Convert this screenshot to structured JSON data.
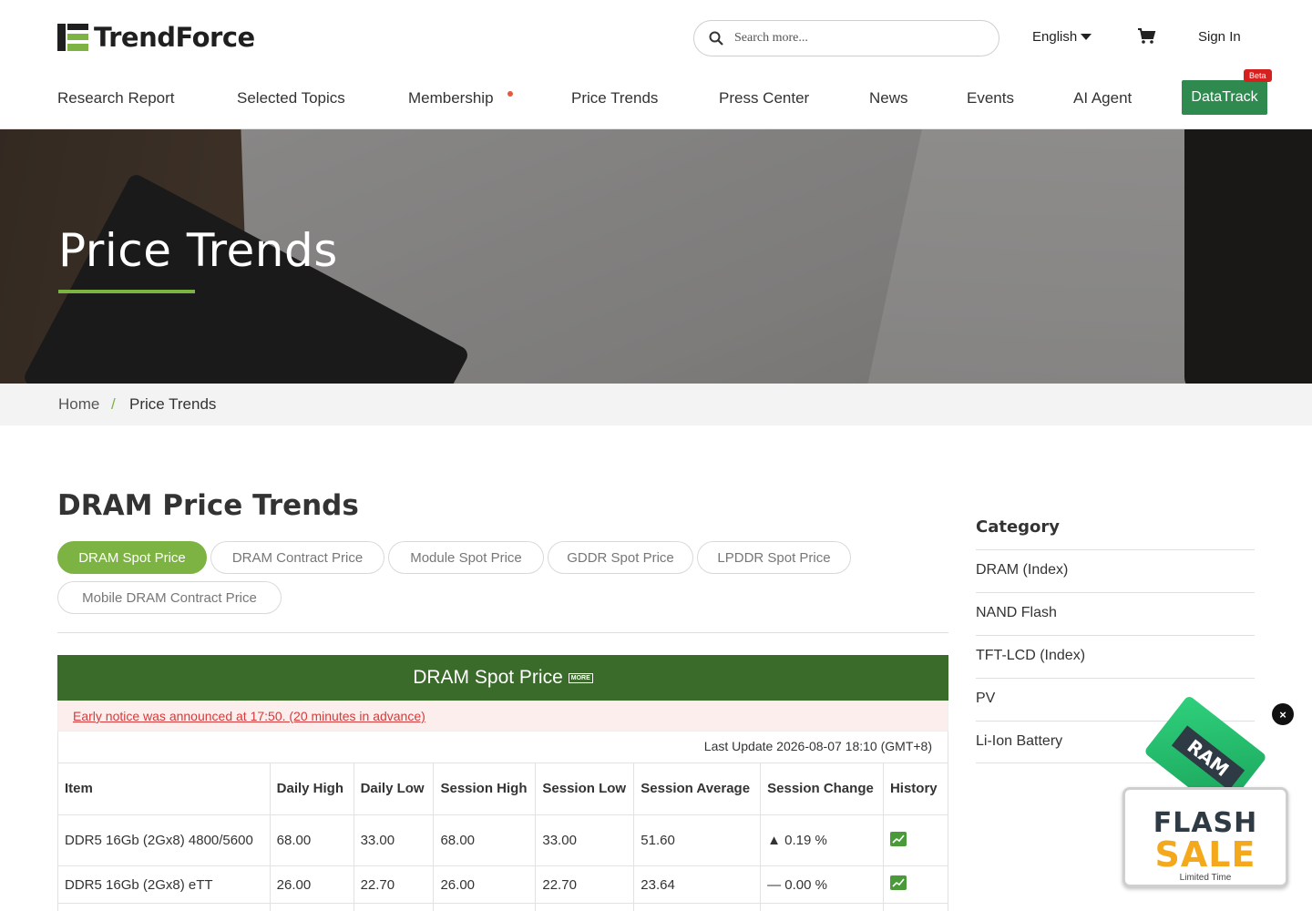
{
  "brand": {
    "name": "TrendForce",
    "accent": "#7cb342",
    "dark_green": "#3a6b2a"
  },
  "header": {
    "search_placeholder": "Search more...",
    "language": "English",
    "sign_in": "Sign In"
  },
  "nav": {
    "items": [
      "Research Report",
      "Selected Topics",
      "Membership",
      "Price Trends",
      "Press Center",
      "News",
      "Events",
      "AI Agent"
    ],
    "datatrack": "DataTrack",
    "beta": "Beta"
  },
  "hero": {
    "title": "Price Trends"
  },
  "breadcrumb": {
    "home": "Home",
    "separator": "/",
    "current": "Price Trends"
  },
  "main": {
    "title": "DRAM Price Trends",
    "tabs": [
      "DRAM Spot Price",
      "DRAM Contract Price",
      "Module Spot Price",
      "GDDR Spot Price",
      "LPDDR Spot Price",
      "Mobile DRAM Contract Price"
    ],
    "active_tab": "DRAM Spot Price"
  },
  "table": {
    "title": "DRAM Spot Price",
    "more": "MORE",
    "notice": "Early notice was announced at 17:50. (20 minutes in advance)",
    "last_update": "Last Update 2026-08-07 18:10 (GMT+8)",
    "columns": [
      "Item",
      "Daily High",
      "Daily Low",
      "Session High",
      "Session Low",
      "Session Average",
      "Session Change",
      "History"
    ],
    "rows": [
      {
        "item": "DDR5 16Gb (2Gx8) 4800/5600",
        "daily_high": "68.00",
        "daily_low": "33.00",
        "session_high": "68.00",
        "session_low": "33.00",
        "session_average": "51.60",
        "change_symbol": "▲",
        "change": "0.19 %",
        "direction": "up"
      },
      {
        "item": "DDR5 16Gb (2Gx8) eTT",
        "daily_high": "26.00",
        "daily_low": "22.70",
        "session_high": "26.00",
        "session_low": "22.70",
        "session_average": "23.64",
        "change_symbol": "—",
        "change": "0.00 %",
        "direction": "flat"
      }
    ]
  },
  "sidebar": {
    "title": "Category",
    "items": [
      "DRAM (Index)",
      "NAND Flash",
      "TFT-LCD (Index)",
      "PV",
      "Li-Ion Battery"
    ]
  },
  "promo": {
    "chip": "RAM",
    "line1": "FLASH",
    "line2": "SALE",
    "tagline": "Limited Time",
    "close": "×"
  }
}
